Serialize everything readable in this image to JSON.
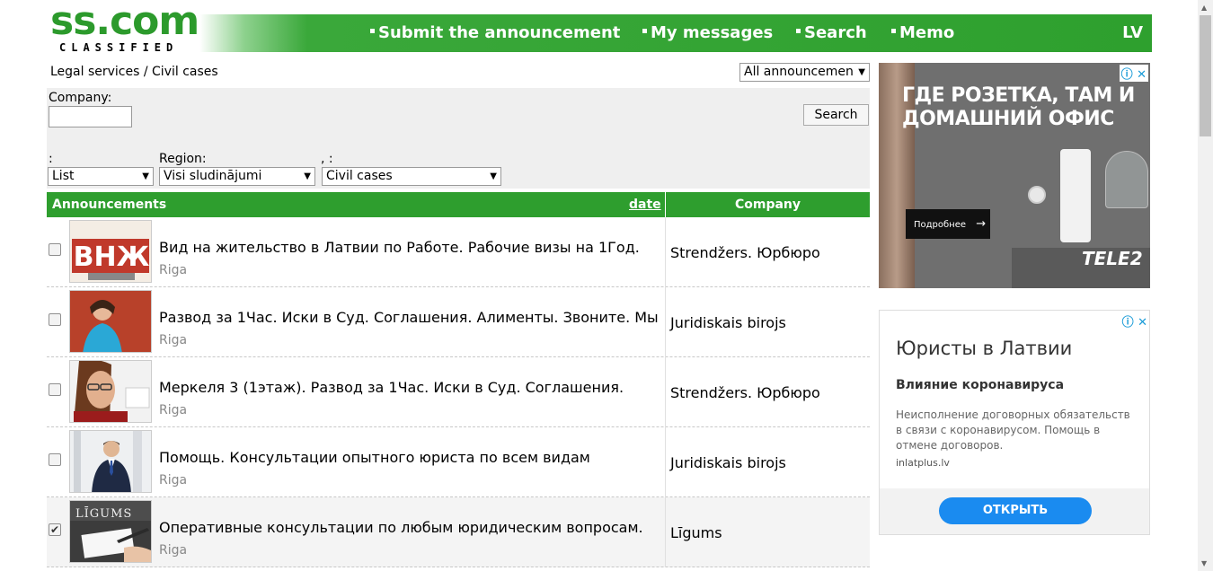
{
  "header": {
    "logo_main": "ss.com",
    "logo_sub": "CLASSIFIED",
    "nav": [
      {
        "label": "Submit the announcement"
      },
      {
        "label": "My messages"
      },
      {
        "label": "Search"
      },
      {
        "label": "Memo"
      }
    ],
    "lang": "LV"
  },
  "breadcrumb": "Legal services / Civil cases",
  "top_filter": {
    "selected": "All announcemen"
  },
  "filter": {
    "company_label": "Company:",
    "search_button": "Search",
    "view_label": ":",
    "view_selected": "List",
    "region_label": "Region:",
    "region_selected": "Visi sludinājumi",
    "category_label": ", :",
    "category_selected": "Civil cases"
  },
  "table": {
    "col_announcements": "Announcements",
    "col_date": "date",
    "col_company": "Company",
    "rows": [
      {
        "title": "Вид на жительство в Латвии по Работе. Рабочие визы на 1Год.",
        "city": "Riga",
        "company": "Strendžers. Юрбюро",
        "checked": false
      },
      {
        "title": "Развод за 1Час. Иски в Суд. Соглашения. Алименты. Звоните. Мы",
        "city": "Riga",
        "company": "Juridiskais birojs",
        "checked": false
      },
      {
        "title": "Меркеля 3 (1этаж). Развод за 1Час. Иски в Суд. Соглашения.",
        "city": "Riga",
        "company": "Strendžers. Юрбюро",
        "checked": false
      },
      {
        "title": "Помощь. Консультации опытного юриста по всем видам",
        "city": "Riga",
        "company": "Juridiskais birojs",
        "checked": false
      },
      {
        "title": "Оперативные консультации по любым юридическим вопросам.",
        "city": "Riga",
        "company": "Līgums",
        "checked": true
      }
    ]
  },
  "ad1": {
    "headline": "ГДЕ РОЗЕТКА, ТАМ И ДОМАШНИЙ ОФИС",
    "button": "Подробнее",
    "brand": "TELE2"
  },
  "ad2": {
    "title": "Юристы в Латвии",
    "subtitle": "Влияние коронавируса",
    "body": "Неисполнение договорных обязательств в связи с коронавирусом. Помощь в отмене договоров.",
    "url": "inlatplus.lv",
    "cta": "ОТКРЫТЬ"
  },
  "colors": {
    "brand_green": "#2e9e2e",
    "cta_blue": "#1a8bf0"
  }
}
